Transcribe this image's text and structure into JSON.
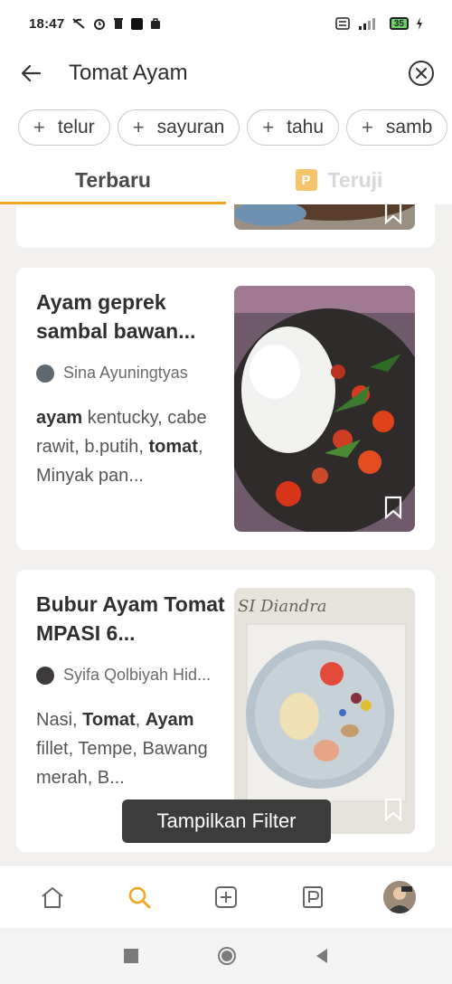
{
  "status_bar": {
    "time": "18:47",
    "battery": "35",
    "network": "4G+"
  },
  "header": {
    "search_value": "Tomat Ayam",
    "back_icon": "arrow-left-icon",
    "clear_icon": "close-circle-icon"
  },
  "chips": [
    {
      "label": "telur"
    },
    {
      "label": "sayuran"
    },
    {
      "label": "tahu"
    },
    {
      "label": "samb"
    }
  ],
  "tabs": [
    {
      "label": "Terbaru",
      "active": true
    },
    {
      "label": "Teruji",
      "active": false
    }
  ],
  "recipes": [
    {
      "title": "Ayam geprek sambal bawan...",
      "author": "Sina Ayuningtyas",
      "ingredients": [
        {
          "text": "ayam",
          "bold": true
        },
        {
          "text": " kentucky, cabe rawit, b.putih, ",
          "bold": false
        },
        {
          "text": "tomat",
          "bold": true
        },
        {
          "text": ", Minyak pan...",
          "bold": false
        }
      ]
    },
    {
      "title": "Bubur Ayam Tomat MPASI 6...",
      "author": "Syifa Qolbiyah Hid...",
      "image_caption": "SI Diandra",
      "ingredients": [
        {
          "text": "Nasi, ",
          "bold": false
        },
        {
          "text": "Tomat",
          "bold": true
        },
        {
          "text": ", ",
          "bold": false
        },
        {
          "text": "Ayam",
          "bold": true
        },
        {
          "text": " fillet, Tempe, Bawang merah, B...",
          "bold": false
        }
      ]
    }
  ],
  "filter_button": "Tampilkan Filter",
  "nav": [
    "home-icon",
    "search-icon",
    "add-icon",
    "premium-icon",
    "profile-avatar"
  ],
  "colors": {
    "accent": "#f5a524",
    "background": "#f2f1ef",
    "card": "#ffffff",
    "toast": "#3c3c3c"
  }
}
